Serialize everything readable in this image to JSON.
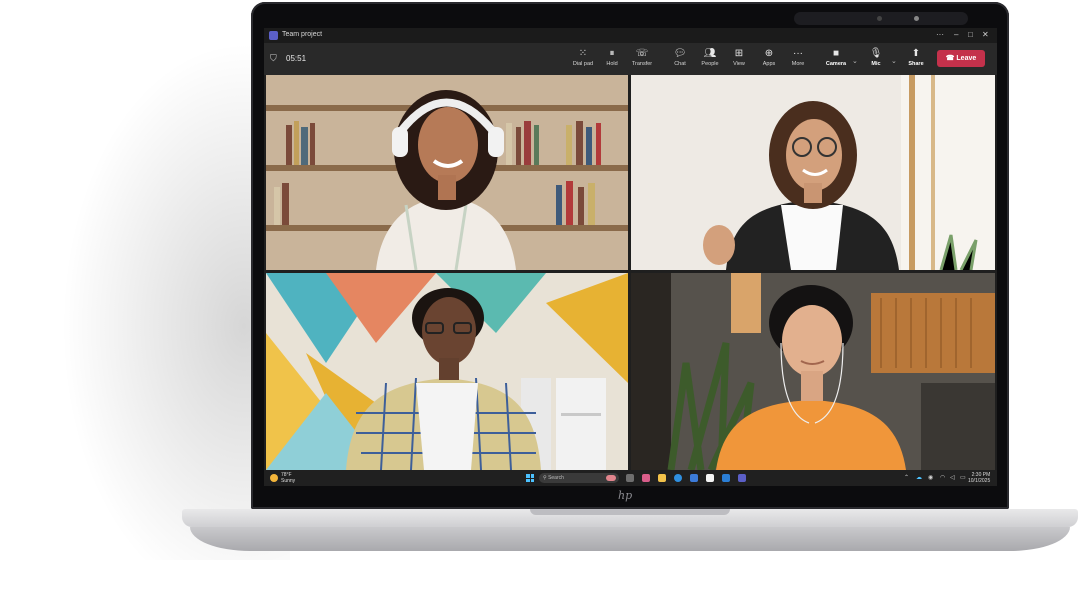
{
  "window": {
    "title": "Team project"
  },
  "call": {
    "timer": "05:51"
  },
  "toolbar": {
    "dial_pad": "Dial pad",
    "hold": "Hold",
    "transfer": "Transfer",
    "chat": "Chat",
    "people": "People",
    "view": "View",
    "apps": "Apps",
    "more": "More",
    "camera": "Camera",
    "mic": "Mic",
    "share": "Share",
    "leave": "Leave"
  },
  "taskbar": {
    "temperature": "78°F",
    "weather": "Sunny",
    "search_placeholder": "Search",
    "time": "2:30 PM",
    "date": "10/1/2025"
  },
  "colors": {
    "leave": "#c4314b",
    "toolbar": "#292929",
    "brand": "#5b5fc7"
  }
}
